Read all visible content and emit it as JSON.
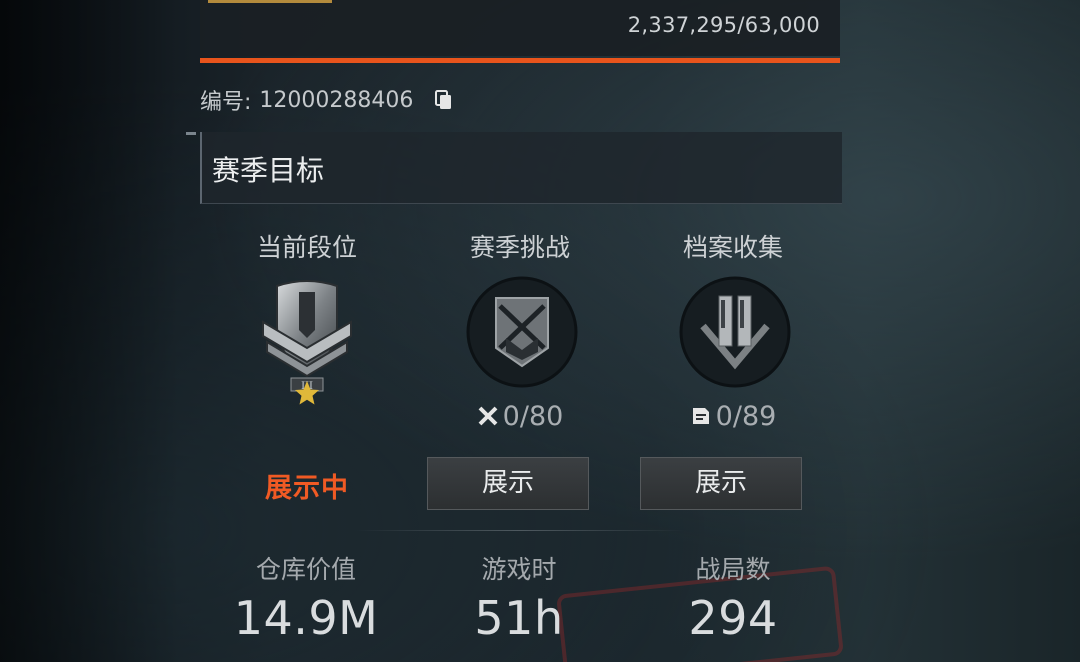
{
  "experience": {
    "value": "2,337,295/63,000"
  },
  "id_row": {
    "label": "编号:",
    "value": "12000288406"
  },
  "section": {
    "title": "赛季目标"
  },
  "columns": [
    {
      "title": "当前段位",
      "status": "展示中"
    },
    {
      "title": "赛季挑战",
      "progress": "0/80",
      "button": "展示"
    },
    {
      "title": "档案收集",
      "progress": "0/89",
      "button": "展示"
    }
  ],
  "rank": {
    "tier": "III",
    "stars": 1
  },
  "stats": [
    {
      "label": "仓库价值",
      "value": "14.9M"
    },
    {
      "label": "游戏时",
      "value": "51h"
    },
    {
      "label": "战局数",
      "value": "294"
    }
  ],
  "colors": {
    "accent": "#e8541c",
    "showing": "#f05a24",
    "star": "#e0b83a"
  },
  "icons": [
    "copy-icon",
    "rank-emblem-icon",
    "star-icon",
    "crossed-rifles-icon",
    "double-chevron-icon",
    "swords-icon",
    "document-icon"
  ]
}
